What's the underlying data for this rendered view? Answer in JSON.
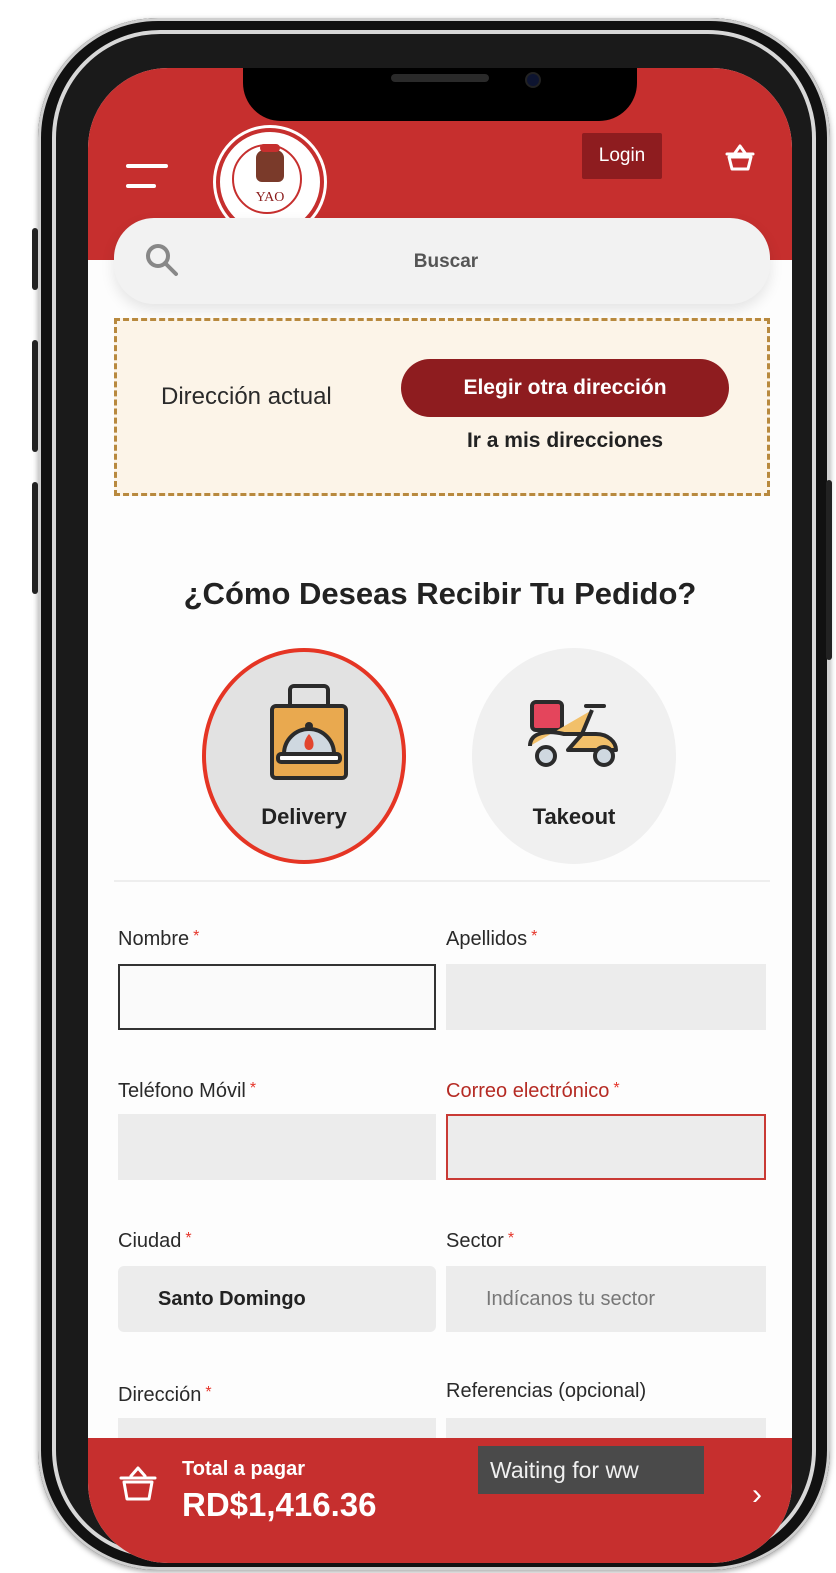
{
  "header": {
    "logo_text": "YAO",
    "login_label": "Login"
  },
  "search": {
    "placeholder": "Buscar"
  },
  "address": {
    "current_label": "Dirección actual",
    "choose_button": "Elegir otra dirección",
    "my_addresses_link": "Ir a mis direcciones"
  },
  "delivery": {
    "question": "¿Cómo Deseas Recibir Tu Pedido?",
    "options": [
      {
        "label": "Delivery",
        "selected": true
      },
      {
        "label": "Takeout",
        "selected": false
      }
    ]
  },
  "form": {
    "required_mark": "*",
    "nombre": {
      "label": "Nombre",
      "value": ""
    },
    "apellidos": {
      "label": "Apellidos",
      "value": ""
    },
    "telefono": {
      "label": "Teléfono Móvil",
      "value": ""
    },
    "correo": {
      "label": "Correo electrónico",
      "value": ""
    },
    "ciudad": {
      "label": "Ciudad",
      "value": "Santo Domingo"
    },
    "sector": {
      "label": "Sector",
      "placeholder": "Indícanos tu sector"
    },
    "direccion": {
      "label": "Dirección"
    },
    "referencias": {
      "label": "Referencias (opcional)"
    }
  },
  "total": {
    "label": "Total a pagar",
    "amount": "RD$1,416.36",
    "arrow": "›"
  },
  "browser_status": "Waiting for ww",
  "colors": {
    "brand_red": "#c62f2e",
    "dark_red": "#8e1c1f",
    "error_red": "#c93a35"
  }
}
